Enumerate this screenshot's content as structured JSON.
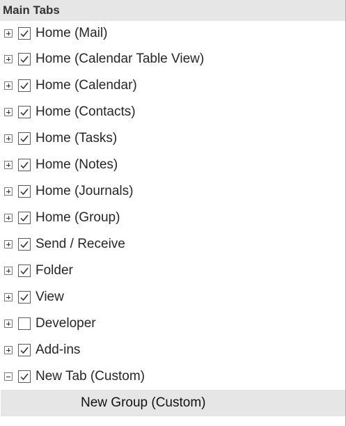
{
  "header": {
    "title": "Main Tabs"
  },
  "tabs": [
    {
      "label": "Home (Mail)",
      "checked": true,
      "expanded": false
    },
    {
      "label": "Home (Calendar Table View)",
      "checked": true,
      "expanded": false
    },
    {
      "label": "Home (Calendar)",
      "checked": true,
      "expanded": false
    },
    {
      "label": "Home (Contacts)",
      "checked": true,
      "expanded": false
    },
    {
      "label": "Home (Tasks)",
      "checked": true,
      "expanded": false
    },
    {
      "label": "Home (Notes)",
      "checked": true,
      "expanded": false
    },
    {
      "label": "Home (Journals)",
      "checked": true,
      "expanded": false
    },
    {
      "label": "Home (Group)",
      "checked": true,
      "expanded": false
    },
    {
      "label": "Send / Receive",
      "checked": true,
      "expanded": false
    },
    {
      "label": "Folder",
      "checked": true,
      "expanded": false
    },
    {
      "label": "View",
      "checked": true,
      "expanded": false
    },
    {
      "label": "Developer",
      "checked": false,
      "expanded": false
    },
    {
      "label": "Add-ins",
      "checked": true,
      "expanded": false
    },
    {
      "label": "New Tab (Custom)",
      "checked": true,
      "expanded": true
    }
  ],
  "selected_group": {
    "label": "New Group (Custom)"
  },
  "icons": {
    "expand": "plus-box-icon",
    "collapse": "minus-box-icon",
    "check": "checkmark-icon"
  }
}
